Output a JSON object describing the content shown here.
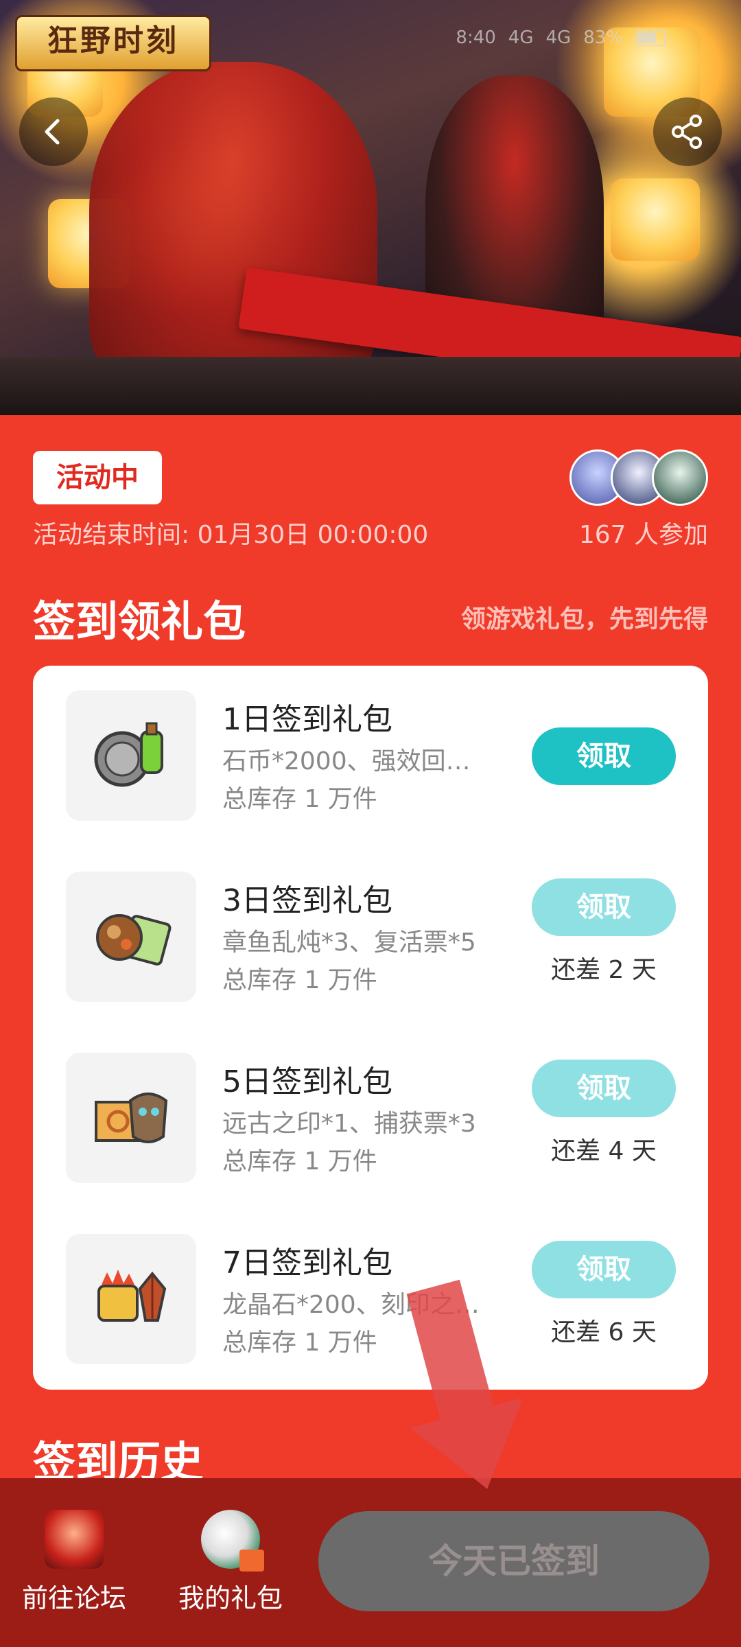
{
  "banner": {
    "logo_text": "狂野时刻",
    "status": {
      "time": "8:40",
      "net1": "4G",
      "net2": "4G",
      "battery": "83%"
    }
  },
  "activity": {
    "status_badge": "活动中",
    "end_time": "活动结束时间: 01月30日 00:00:00",
    "participants": "167 人参加"
  },
  "signin": {
    "title": "签到领礼包",
    "hint": "领游戏礼包，先到先得",
    "gifts": [
      {
        "name": "1日签到礼包",
        "items": "石币*2000、强效回…",
        "stock": "总库存 1 万件",
        "button": "领取",
        "remain": ""
      },
      {
        "name": "3日签到礼包",
        "items": "章鱼乱炖*3、复活票*5",
        "stock": "总库存 1 万件",
        "button": "领取",
        "remain": "还差 2 天"
      },
      {
        "name": "5日签到礼包",
        "items": "远古之印*1、捕获票*3",
        "stock": "总库存 1 万件",
        "button": "领取",
        "remain": "还差 4 天"
      },
      {
        "name": "7日签到礼包",
        "items": "龙晶石*200、刻印之…",
        "stock": "总库存 1 万件",
        "button": "领取",
        "remain": "还差 6 天"
      }
    ]
  },
  "history": {
    "title": "签到历史"
  },
  "bottom": {
    "forum_label": "前往论坛",
    "my_gifts_label": "我的礼包",
    "checked_label": "今天已签到"
  },
  "colors": {
    "page_bg": "#f03a2a",
    "accent": "#1ec1c4",
    "bottom_bg": "#9c1c16"
  }
}
